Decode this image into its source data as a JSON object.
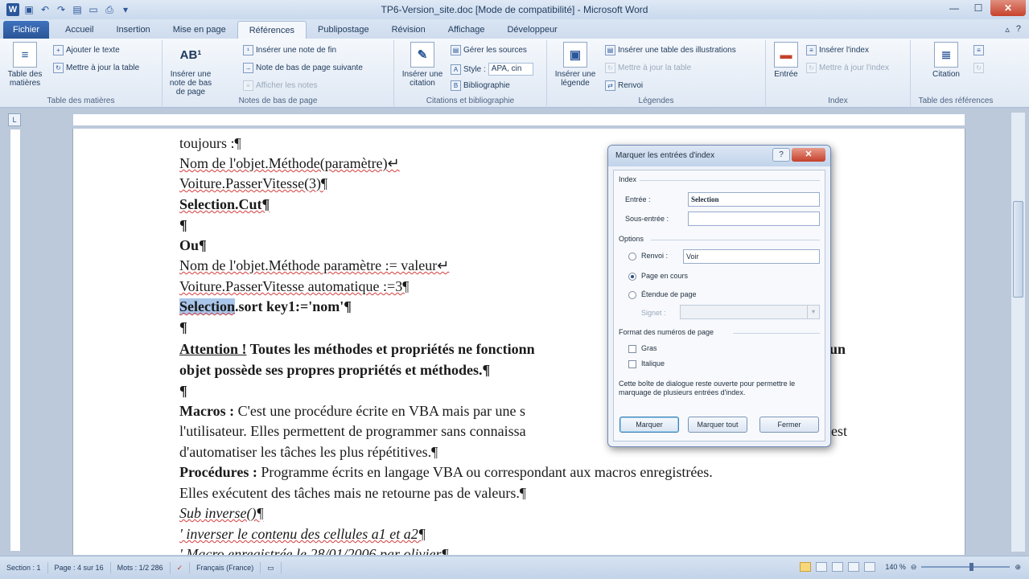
{
  "window": {
    "title": "TP6-Version_site.doc [Mode de compatibilité] - Microsoft Word"
  },
  "tabs": [
    "Fichier",
    "Accueil",
    "Insertion",
    "Mise en page",
    "Références",
    "Publipostage",
    "Révision",
    "Affichage",
    "Développeur"
  ],
  "ribbon": {
    "toc": {
      "label": "Table des matières",
      "table_btn": "Table des matières",
      "add_text": "Ajouter le texte",
      "update_table": "Mettre à jour la table"
    },
    "footnotes": {
      "label": "Notes de bas de page",
      "insert_note": "Insérer une note de bas de page",
      "insert_endnote": "Insérer une note de fin",
      "next_note": "Note de bas de page suivante",
      "show_notes": "Afficher les notes"
    },
    "citations": {
      "label": "Citations et bibliographie",
      "insert_citation": "Insérer une citation",
      "manage_sources": "Gérer les sources",
      "style_label": "Style :",
      "style_value": "APA, cin",
      "bibliography": "Bibliographie"
    },
    "captions": {
      "label": "Légendes",
      "insert_caption": "Insérer une légende",
      "insert_table_figures": "Insérer une table des illustrations",
      "update_table": "Mettre à jour la table",
      "crossref": "Renvoi"
    },
    "index": {
      "label": "Index",
      "entry": "Entrée",
      "insert_index": "Insérer l'index",
      "update_index": "Mettre à jour l'index"
    },
    "toa": {
      "label": "Table des références",
      "citation": "Citation"
    }
  },
  "document": {
    "lines": [
      "toujours :¶",
      "Nom de l'objet.Méthode(paramètre)↵",
      "Voiture.PasserVitesse(3)¶",
      "Selection.Cut¶",
      "¶",
      "Ou¶",
      "Nom de l'objet.Méthode paramètre := valeur↵",
      "Voiture.PasserVitesse automatique :=3¶",
      "Selection",
      ".sort key1:='nom'¶",
      "¶",
      "Attention !",
      " Toutes les méthodes et propriétés ne fonctionn",
      "un",
      "objet possède ses propres propriétés et méthodes.¶",
      "¶",
      "Macros :",
      " C'est une procédure écrite en VBA mais par une s",
      "l'utilisateur. Elles permettent de programmer sans connaissa",
      "est",
      "d'automatiser les tâches les plus répétitives.¶",
      "Procédures :",
      " Programme écrits en langage VBA ou correspondant aux macros enregistrées.",
      "Elles exécutent des tâches mais ne retourne pas de valeurs.¶",
      "Sub",
      " inverse()¶",
      "' inverser le contenu des cellules a1 et a2¶",
      "' Macro enregistrée le 28/01/2006 par olivier¶"
    ]
  },
  "dialog": {
    "title": "Marquer les entrées d'index",
    "help": "?",
    "close": "✕",
    "section_index": "Index",
    "entry_label": "Entrée :",
    "entry_value": "Selection",
    "subentry_label": "Sous-entrée :",
    "subentry_value": "",
    "section_options": "Options",
    "opt_crossref": "Renvoi :",
    "crossref_value": "Voir",
    "opt_current_page": "Page en cours",
    "opt_page_range": "Étendue de page",
    "bookmark_label": "Signet :",
    "bookmark_value": "",
    "section_format": "Format des numéros de page",
    "bold": "Gras",
    "italic": "Italique",
    "info": "Cette boîte de dialogue reste ouverte pour permettre le marquage de plusieurs entrées d'index.",
    "btn_mark": "Marquer",
    "btn_mark_all": "Marquer tout",
    "btn_close": "Fermer"
  },
  "statusbar": {
    "section": "Section : 1",
    "page": "Page : 4 sur 16",
    "words": "Mots : 1/2 286",
    "language": "Français (France)",
    "zoom": "140 %"
  }
}
